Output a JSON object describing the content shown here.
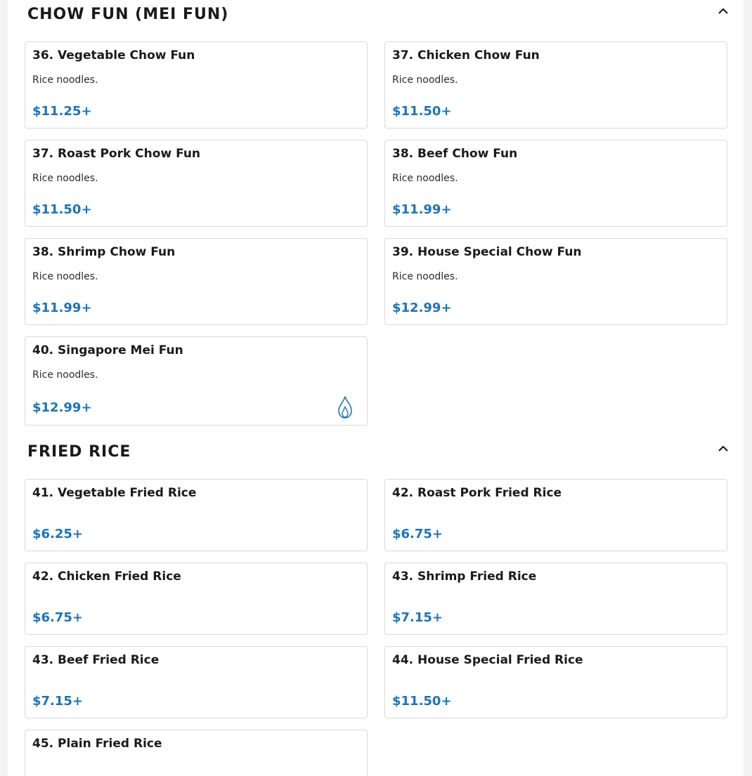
{
  "sections": [
    {
      "title": "CHOW FUN (MEI FUN)",
      "collapse_icon": "chevron-up-icon",
      "items": [
        {
          "name": "36. Vegetable Chow Fun",
          "desc": "Rice noodles.",
          "price": "$11.25+"
        },
        {
          "name": "37. Chicken Chow Fun",
          "desc": "Rice noodles.",
          "price": "$11.50+"
        },
        {
          "name": "37. Roast Pork Chow Fun",
          "desc": "Rice noodles.",
          "price": "$11.50+"
        },
        {
          "name": "38. Beef Chow Fun",
          "desc": "Rice noodles.",
          "price": "$11.99+"
        },
        {
          "name": "38. Shrimp Chow Fun",
          "desc": "Rice noodles.",
          "price": "$11.99+"
        },
        {
          "name": "39. House Special Chow Fun",
          "desc": "Rice noodles.",
          "price": "$12.99+"
        },
        {
          "name": "40. Singapore Mei Fun",
          "desc": "Rice noodles.",
          "price": "$12.99+",
          "icon": "spicy-flame-icon"
        }
      ]
    },
    {
      "title": "FRIED RICE",
      "collapse_icon": "chevron-up-icon",
      "items": [
        {
          "name": "41. Vegetable Fried Rice",
          "price": "$6.25+"
        },
        {
          "name": "42. Roast Pork Fried Rice",
          "price": "$6.75+"
        },
        {
          "name": "42. Chicken Fried Rice",
          "price": "$6.75+"
        },
        {
          "name": "43. Shrimp Fried Rice",
          "price": "$7.15+"
        },
        {
          "name": "43. Beef Fried Rice",
          "price": "$7.15+"
        },
        {
          "name": "44. House Special Fried Rice",
          "price": "$11.50+"
        },
        {
          "name": "45. Plain Fried Rice",
          "price": ""
        }
      ]
    }
  ],
  "colors": {
    "price": "#1f73b7",
    "spicy_icon": "#1f73b7",
    "card_border": "#d9d9d9"
  }
}
